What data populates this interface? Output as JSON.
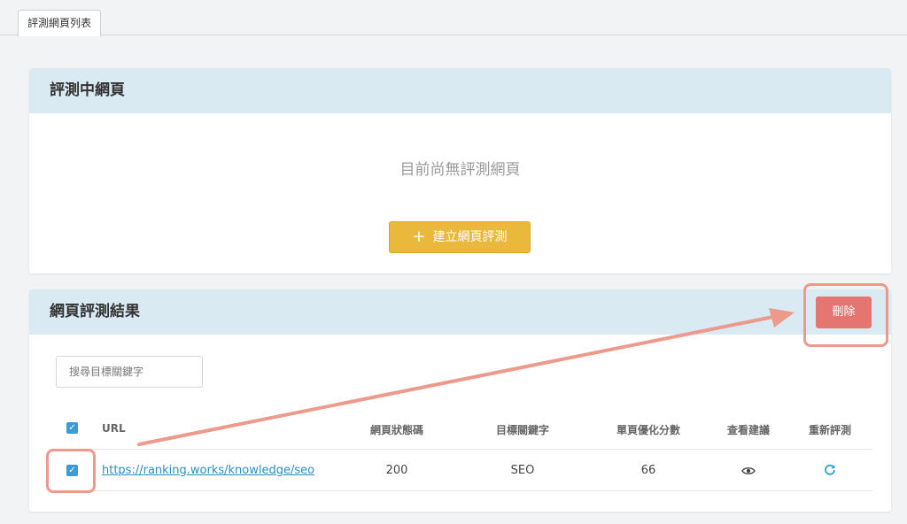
{
  "tabs": [
    {
      "label": "評測網頁列表"
    }
  ],
  "in_progress": {
    "title": "評測中網頁",
    "empty_text": "目前尚無評測網頁",
    "create_button": {
      "icon": "plus-icon",
      "label": "建立網頁評測"
    }
  },
  "results": {
    "title": "網頁評測結果",
    "delete_button": "刪除",
    "search": {
      "placeholder": "搜尋目標關鍵字",
      "value": ""
    },
    "columns": [
      "URL",
      "網頁狀態碼",
      "目標關鍵字",
      "單頁優化分數",
      "查看建議",
      "重新評測"
    ],
    "header_checkbox_checked": true,
    "rows": [
      {
        "checked": true,
        "url": "https://ranking.works/knowledge/seo",
        "status_code": "200",
        "keyword": "SEO",
        "score": "66",
        "view_icon": "eye-icon",
        "retest_icon": "refresh-icon"
      }
    ]
  },
  "colors": {
    "header_bg": "#daeaf2",
    "create_button": "#eab93b",
    "delete_button": "#e57571",
    "link": "#2a8fc2",
    "checkbox": "#3a9bd6",
    "annotation": "#ec9a8c"
  }
}
